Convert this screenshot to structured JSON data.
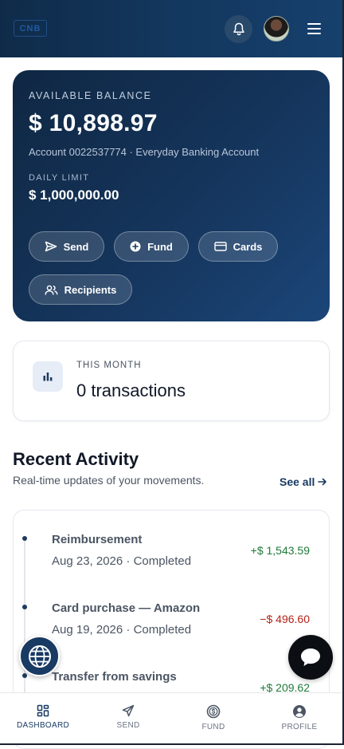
{
  "header": {
    "logo_text": "CNB",
    "icons": [
      "bell-icon",
      "avatar",
      "menu-icon"
    ]
  },
  "balance": {
    "label": "AVAILABLE BALANCE",
    "amount": "$ 10,898.97",
    "account": "Account 0022537774 · Everyday Banking Account",
    "limit_label": "DAILY LIMIT",
    "limit_amount": "$ 1,000,000.00",
    "actions": [
      {
        "label": "Send",
        "icon": "send-icon"
      },
      {
        "label": "Fund",
        "icon": "plus-circle-icon"
      },
      {
        "label": "Cards",
        "icon": "card-icon"
      },
      {
        "label": "Recipients",
        "icon": "users-icon"
      }
    ]
  },
  "month": {
    "label": "THIS MONTH",
    "value": "0 transactions",
    "icon": "bar-chart-icon"
  },
  "activity": {
    "title": "Recent Activity",
    "subtitle": "Real-time updates of your movements.",
    "see_all": "See all",
    "items": [
      {
        "title": "Reimbursement",
        "meta": "Aug 23, 2026 · Completed",
        "amount": "+$ 1,543.59",
        "direction": "credit"
      },
      {
        "title": "Card purchase — Amazon",
        "meta": "Aug 19, 2026 · Completed",
        "amount": "−$ 496.60",
        "direction": "debit"
      },
      {
        "title": "Transfer from savings",
        "meta": "",
        "amount": "+$ 209.62",
        "direction": "credit"
      }
    ]
  },
  "nav": {
    "items": [
      {
        "label": "DASHBOARD",
        "icon": "dashboard-icon",
        "active": true
      },
      {
        "label": "SEND",
        "icon": "send-icon",
        "active": false
      },
      {
        "label": "FUND",
        "icon": "dollar-circle-icon",
        "active": false
      },
      {
        "label": "PROFILE",
        "icon": "user-icon",
        "active": false
      }
    ]
  },
  "colors": {
    "brand_navy": "#0f2b49",
    "positive": "#1f7a3a",
    "negative": "#b42318"
  }
}
